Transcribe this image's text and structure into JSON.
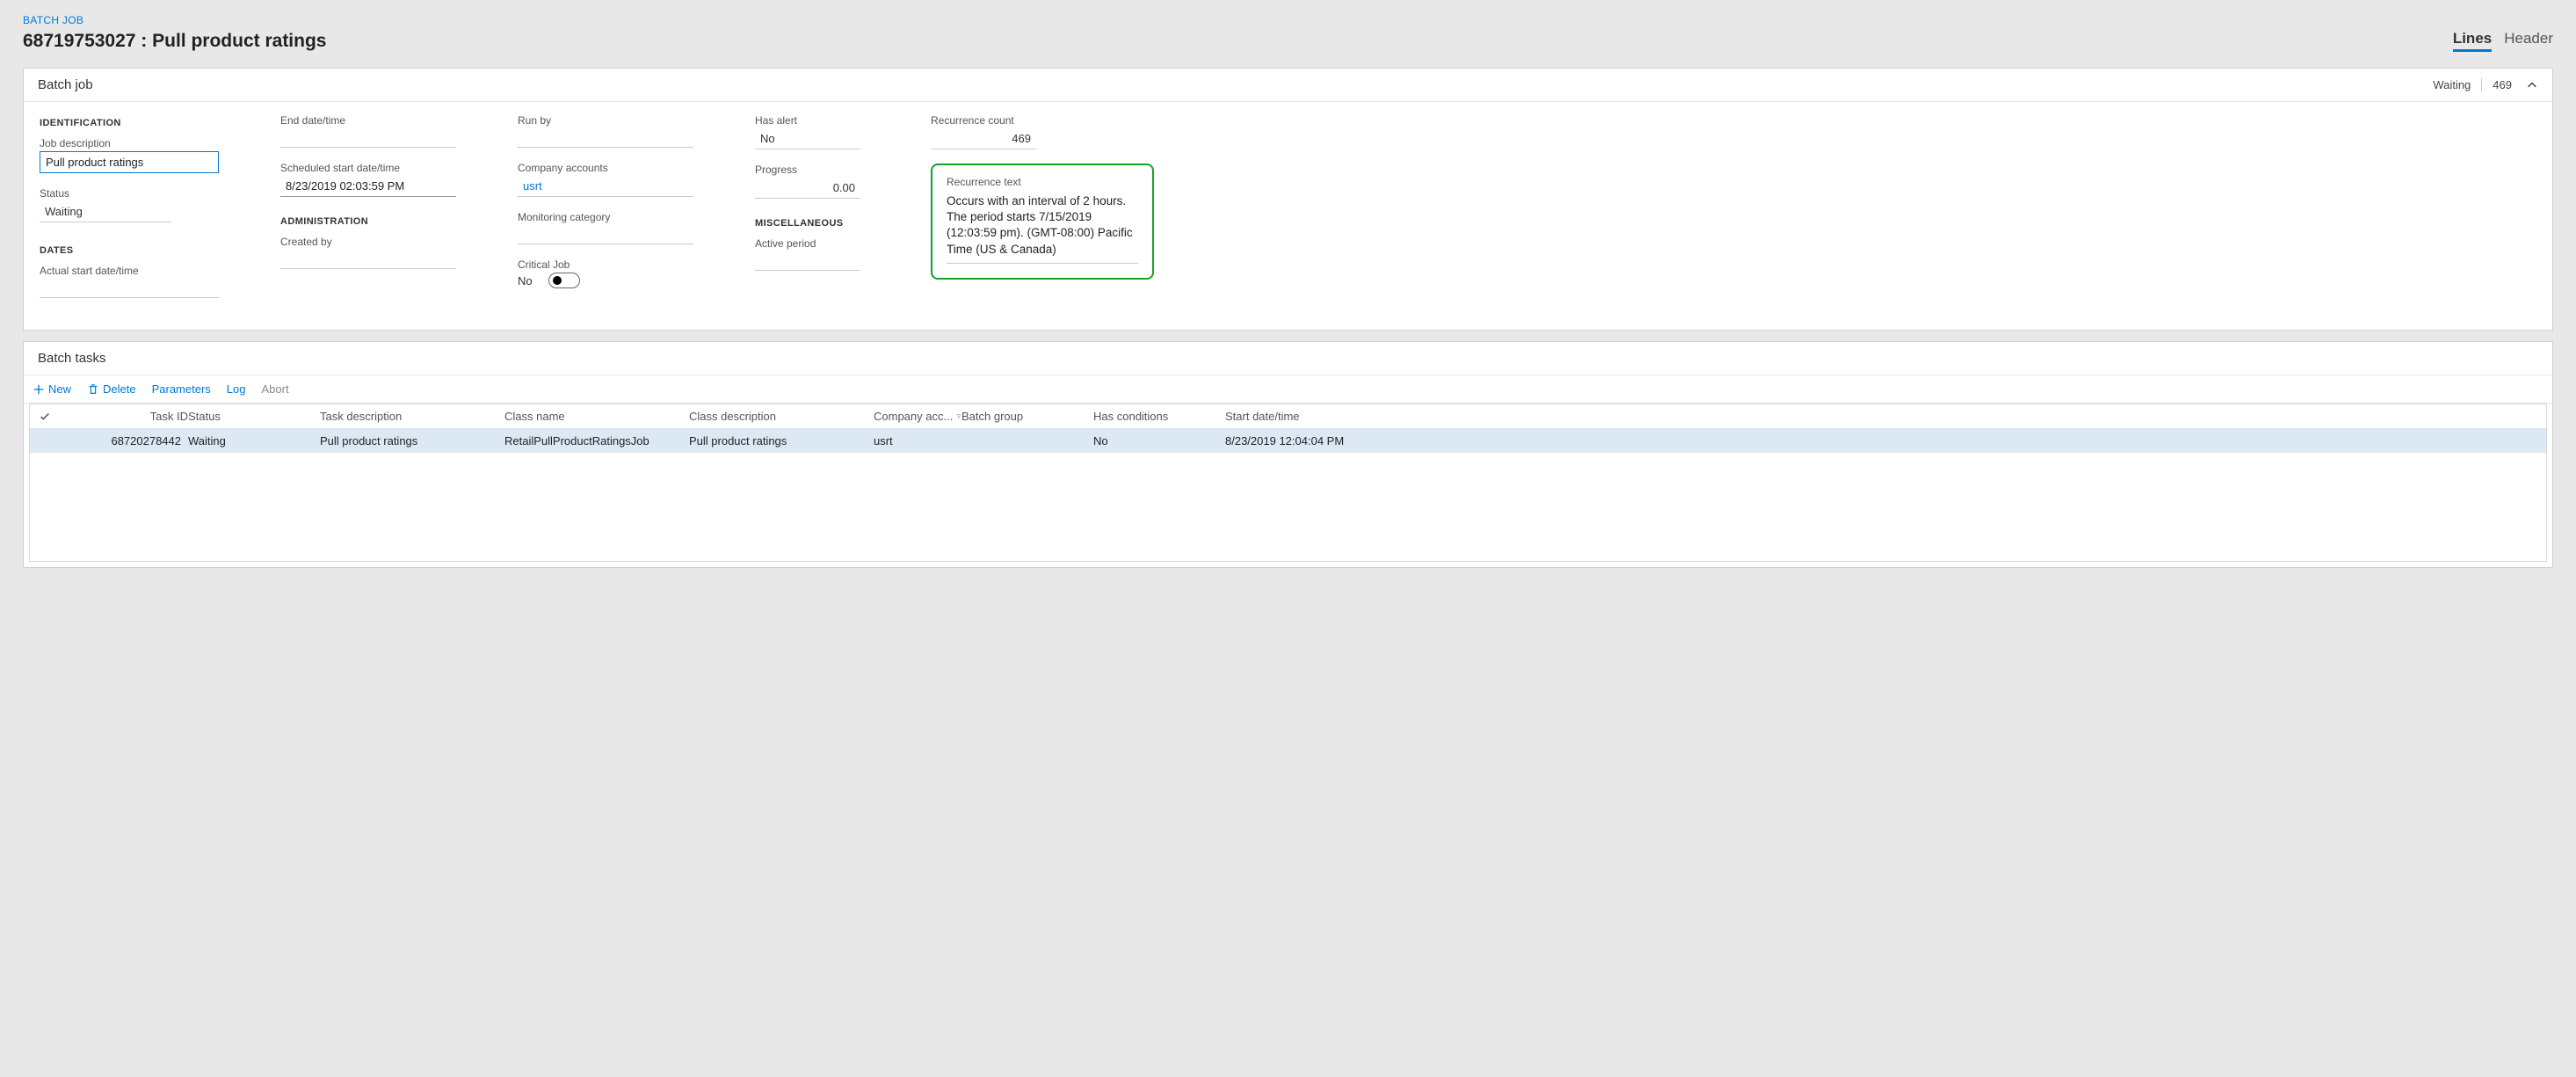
{
  "breadcrumb": "BATCH JOB",
  "page_title": "68719753027 : Pull product ratings",
  "tabs": {
    "lines": "Lines",
    "header": "Header"
  },
  "batch_job_card": {
    "title": "Batch job",
    "status_tag": "Waiting",
    "count": "469",
    "identification": {
      "heading": "IDENTIFICATION",
      "job_description_label": "Job description",
      "job_description_value": "Pull product ratings",
      "status_label": "Status",
      "status_value": "Waiting"
    },
    "dates": {
      "heading": "DATES",
      "actual_start_label": "Actual start date/time",
      "actual_start_value": "",
      "end_label": "End date/time",
      "end_value": "",
      "scheduled_label": "Scheduled start date/time",
      "scheduled_value": "8/23/2019 02:03:59 PM"
    },
    "administration": {
      "heading": "ADMINISTRATION",
      "created_by_label": "Created by",
      "created_by_value": "",
      "run_by_label": "Run by",
      "run_by_value": "",
      "company_accounts_label": "Company accounts",
      "company_accounts_value": "usrt",
      "monitoring_label": "Monitoring category",
      "monitoring_value": "",
      "critical_label": "Critical Job",
      "critical_value": "No"
    },
    "alert_progress": {
      "has_alert_label": "Has alert",
      "has_alert_value": "No",
      "progress_label": "Progress",
      "progress_value": "0.00"
    },
    "misc": {
      "heading": "MISCELLANEOUS",
      "active_period_label": "Active period",
      "active_period_value": "",
      "recurrence_count_label": "Recurrence count",
      "recurrence_count_value": "469",
      "recurrence_text_label": "Recurrence text",
      "recurrence_text_value": "Occurs with an interval of 2 hours. The period starts 7/15/2019 (12:03:59 pm). (GMT-08:00) Pacific Time (US & Canada)"
    }
  },
  "batch_tasks_card": {
    "title": "Batch tasks",
    "toolbar": {
      "new": "New",
      "delete": "Delete",
      "parameters": "Parameters",
      "log": "Log",
      "abort": "Abort"
    },
    "columns": {
      "task_id": "Task ID",
      "status": "Status",
      "task_description": "Task description",
      "class_name": "Class name",
      "class_description": "Class description",
      "company_acc": "Company acc...",
      "batch_group": "Batch group",
      "has_conditions": "Has conditions",
      "start_date": "Start date/time"
    },
    "rows": [
      {
        "task_id": "68720278442",
        "status": "Waiting",
        "task_description": "Pull product ratings",
        "class_name": "RetailPullProductRatingsJob",
        "class_description": "Pull product ratings",
        "company_acc": "usrt",
        "batch_group": "",
        "has_conditions": "No",
        "start_date": "8/23/2019 12:04:04 PM"
      }
    ]
  }
}
